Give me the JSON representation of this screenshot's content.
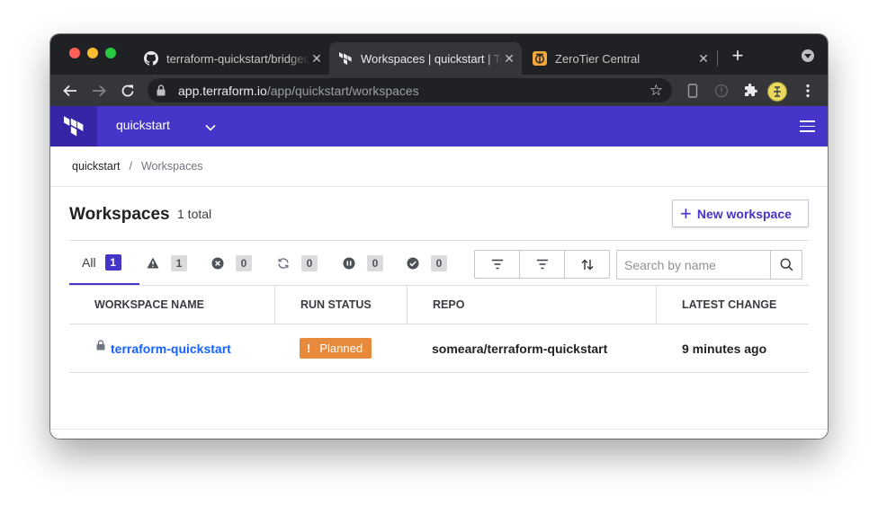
{
  "browser": {
    "tabs": [
      {
        "title": "terraform-quickstart/bridgecrew",
        "favicon": "github-icon",
        "active": false
      },
      {
        "title": "Workspaces | quickstart | Terraform",
        "favicon": "terraform-icon",
        "active": true
      },
      {
        "title": "ZeroTier Central",
        "favicon": "zerotier-icon",
        "active": false
      }
    ],
    "close_glyph": "✕",
    "new_tab_glyph": "+",
    "url_host": "app.terraform.io",
    "url_path": "/app/quickstart/workspaces"
  },
  "header": {
    "org_name": "quickstart",
    "brand_color": "#4535c8"
  },
  "breadcrumb": {
    "org": "quickstart",
    "separator": "/",
    "current": "Workspaces"
  },
  "page": {
    "title": "Workspaces",
    "total": "1 total",
    "new_button_plus": "+",
    "new_button_label": "New workspace"
  },
  "filters": {
    "tabs": [
      {
        "label": "All",
        "count": "1",
        "icon": null,
        "active": true
      },
      {
        "label": "",
        "count": "1",
        "icon": "warning-icon",
        "active": false
      },
      {
        "label": "",
        "count": "0",
        "icon": "error-icon",
        "active": false
      },
      {
        "label": "",
        "count": "0",
        "icon": "running-icon",
        "active": false
      },
      {
        "label": "",
        "count": "0",
        "icon": "paused-icon",
        "active": false
      },
      {
        "label": "",
        "count": "0",
        "icon": "success-icon",
        "active": false
      }
    ],
    "search_placeholder": "Search by name"
  },
  "table": {
    "columns": [
      "WORKSPACE NAME",
      "RUN STATUS",
      "REPO",
      "LATEST CHANGE"
    ],
    "rows": [
      {
        "name": "terraform-quickstart",
        "status_glyph": "!",
        "status": "Planned",
        "status_color": "#e88a3b",
        "repo": "someara/terraform-quickstart",
        "latest_change": "9 minutes ago"
      }
    ]
  }
}
